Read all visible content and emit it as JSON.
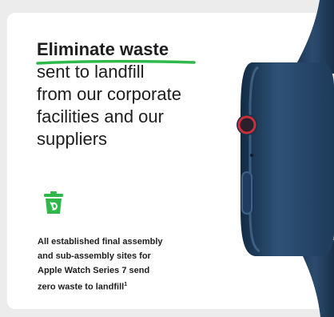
{
  "headline": {
    "emphasis": "Eliminate waste",
    "line1": "sent to landfill",
    "line2": "from our corporate",
    "line3": "facilities and our",
    "line4": "suppliers"
  },
  "caption": {
    "line1": "All established final assembly",
    "line2": "and  sub-assembly sites for",
    "line3": "Apple Watch Series 7 send",
    "line4": "zero waste to landfill",
    "footnote_marker": "1"
  },
  "colors": {
    "accent_green": "#2fb84a",
    "text": "#1d1d1f",
    "watch_blue": "#23405e",
    "crown_red": "#c8313a"
  },
  "icons": {
    "trash": "recycle-trash-icon",
    "watch": "apple-watch-illustration"
  }
}
